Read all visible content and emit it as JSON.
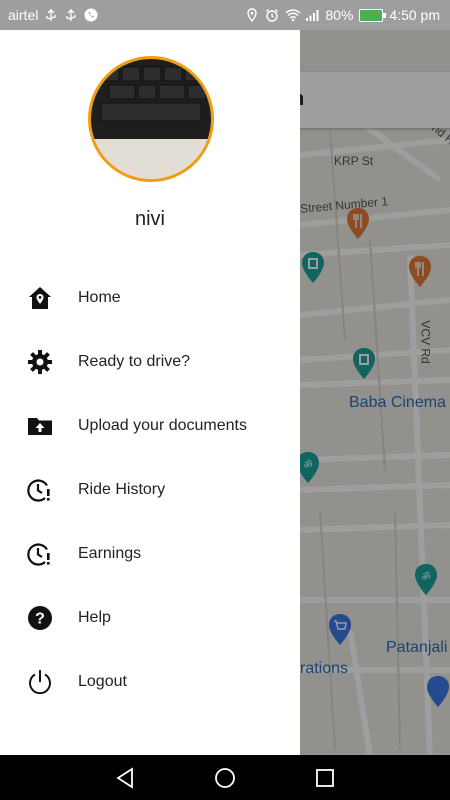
{
  "status_bar": {
    "carrier": "airtel",
    "battery": "80%",
    "time": "4:50 pm"
  },
  "map": {
    "search_text": "n",
    "labels": {
      "road1": "Brooke Bond Rd",
      "road2": "KRP St",
      "road3": "Street Number 1",
      "road4": "VCV Rd",
      "poi1": "Baba Cinema",
      "poi2": "Patanjali",
      "poi3": "rations"
    }
  },
  "drawer": {
    "username": "nivi",
    "menu": [
      {
        "label": "Home",
        "icon": "home-icon"
      },
      {
        "label": "Ready to drive?",
        "icon": "gear-icon"
      },
      {
        "label": "Upload your documents",
        "icon": "upload-folder-icon"
      },
      {
        "label": "Ride History",
        "icon": "clock-alert-icon"
      },
      {
        "label": "Earnings",
        "icon": "clock-alert-icon"
      },
      {
        "label": "Help",
        "icon": "help-icon"
      },
      {
        "label": "Logout",
        "icon": "power-icon"
      }
    ]
  },
  "colors": {
    "avatar_border": "#f39c12",
    "poi_blue": "#2a6fb8",
    "poi_teal": "#1ba39c",
    "poi_orange": "#e07b39"
  }
}
